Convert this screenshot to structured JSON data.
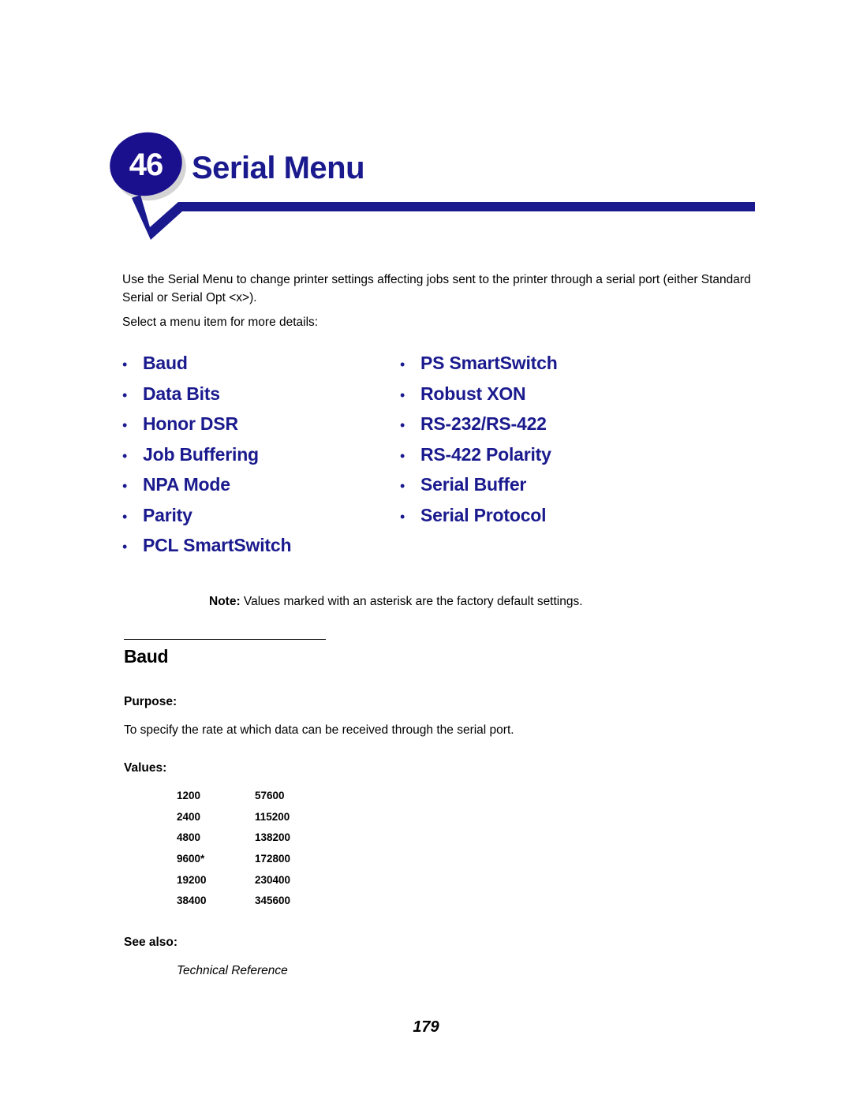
{
  "header": {
    "badge_number": "46",
    "title": "Serial Menu",
    "badge_color": "#1a0f8c",
    "title_color": "#1a1a8e",
    "rule_color": "#1a1a8e",
    "shadow_color": "#d4d4d4"
  },
  "intro": {
    "paragraph": "Use the Serial Menu to change printer settings affecting jobs sent to the printer through a serial port (either Standard Serial or Serial Opt <x>).",
    "select_line": "Select a menu item for more details:"
  },
  "menu_links": {
    "bullet": "•",
    "left_column": [
      {
        "label": "Baud"
      },
      {
        "label": "Data Bits"
      },
      {
        "label": "Honor DSR"
      },
      {
        "label": "Job Buffering"
      },
      {
        "label": "NPA Mode"
      },
      {
        "label": "Parity"
      },
      {
        "label": "PCL SmartSwitch"
      }
    ],
    "right_column": [
      {
        "label": "PS SmartSwitch"
      },
      {
        "label": "Robust XON"
      },
      {
        "label": "RS-232/RS-422"
      },
      {
        "label": "RS-422 Polarity"
      },
      {
        "label": "Serial Buffer"
      },
      {
        "label": "Serial Protocol"
      }
    ]
  },
  "note": {
    "label": "Note:",
    "text": "Values marked with an asterisk are the factory default settings."
  },
  "section": {
    "heading": "Baud",
    "purpose_label": "Purpose:",
    "purpose_text": "To specify the rate at which data can be received through the serial port.",
    "values_label": "Values:",
    "values_rows": [
      {
        "col_a": "1200",
        "col_b": "57600"
      },
      {
        "col_a": "2400",
        "col_b": "115200"
      },
      {
        "col_a": "4800",
        "col_b": "138200"
      },
      {
        "col_a": "9600*",
        "col_b": "172800"
      },
      {
        "col_a": "19200",
        "col_b": "230400"
      },
      {
        "col_a": "38400",
        "col_b": "345600"
      }
    ],
    "see_also_label": "See also:",
    "see_also_text": "Technical Reference"
  },
  "footer": {
    "page_number": "179"
  }
}
